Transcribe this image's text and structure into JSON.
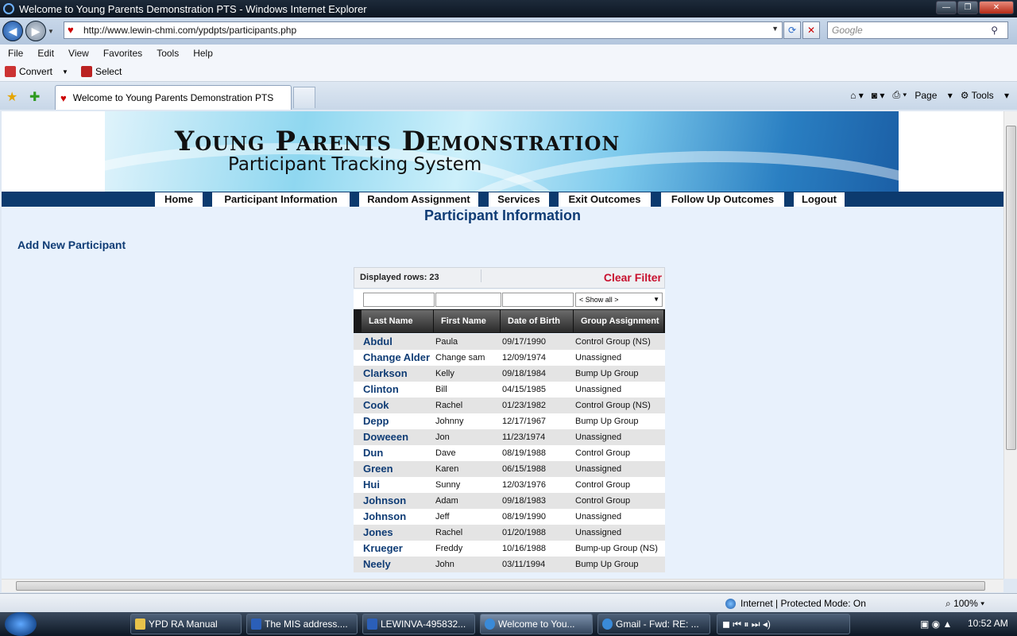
{
  "window": {
    "title": "Welcome to Young Parents Demonstration PTS - Windows Internet Explorer"
  },
  "address": {
    "url": "http://www.lewin-chmi.com/ypdpts/participants.php",
    "search_placeholder": "Google"
  },
  "menu": [
    "File",
    "Edit",
    "View",
    "Favorites",
    "Tools",
    "Help"
  ],
  "links": {
    "convert": "Convert",
    "select": "Select"
  },
  "tab": {
    "title": "Welcome to Young Parents Demonstration PTS"
  },
  "commands": {
    "page": "Page",
    "tools": "Tools"
  },
  "banner": {
    "title": "Young Parents Demonstration",
    "subtitle": "Participant Tracking System"
  },
  "nav": [
    "Home",
    "Participant Information",
    "Random Assignment",
    "Services",
    "Exit Outcomes",
    "Follow Up Outcomes",
    "Logout"
  ],
  "page": {
    "title": "Participant Information",
    "add_link": "Add New Participant"
  },
  "grid": {
    "displayed_rows": "Displayed rows: 23",
    "clear_filter": "Clear Filter",
    "group_filter": "< Show all >",
    "columns": [
      "Last Name",
      "First Name",
      "Date of Birth",
      "Group Assignment"
    ],
    "rows": [
      {
        "last": "Abdul",
        "first": "Paula",
        "dob": "09/17/1990",
        "group": "Control Group (NS)"
      },
      {
        "last": "Change Alder",
        "first": "Change sam",
        "dob": "12/09/1974",
        "group": "Unassigned"
      },
      {
        "last": "Clarkson",
        "first": "Kelly",
        "dob": "09/18/1984",
        "group": "Bump Up Group"
      },
      {
        "last": "Clinton",
        "first": "Bill",
        "dob": "04/15/1985",
        "group": "Unassigned"
      },
      {
        "last": "Cook",
        "first": "Rachel",
        "dob": "01/23/1982",
        "group": "Control Group (NS)"
      },
      {
        "last": "Depp",
        "first": "Johnny",
        "dob": "12/17/1967",
        "group": "Bump Up Group"
      },
      {
        "last": "Doweeen",
        "first": "Jon",
        "dob": "11/23/1974",
        "group": "Unassigned"
      },
      {
        "last": "Dun",
        "first": "Dave",
        "dob": "08/19/1988",
        "group": "Control Group"
      },
      {
        "last": "Green",
        "first": "Karen",
        "dob": "06/15/1988",
        "group": "Unassigned"
      },
      {
        "last": "Hui",
        "first": "Sunny",
        "dob": "12/03/1976",
        "group": "Control Group"
      },
      {
        "last": "Johnson",
        "first": "Adam",
        "dob": "09/18/1983",
        "group": "Control Group"
      },
      {
        "last": "Johnson",
        "first": "Jeff",
        "dob": "08/19/1990",
        "group": "Unassigned"
      },
      {
        "last": "Jones",
        "first": "Rachel",
        "dob": "01/20/1988",
        "group": "Unassigned"
      },
      {
        "last": "Krueger",
        "first": "Freddy",
        "dob": "10/16/1988",
        "group": "Bump-up Group (NS)"
      },
      {
        "last": "Neely",
        "first": "John",
        "dob": "03/11/1994",
        "group": "Bump Up Group"
      }
    ]
  },
  "status": {
    "zone": "Internet | Protected Mode: On",
    "zoom": "100%"
  },
  "taskbar": {
    "items": [
      "YPD RA Manual",
      "The MIS address....",
      "LEWINVA-495832...",
      "Welcome to You...",
      "Gmail - Fwd: RE: ..."
    ],
    "clock": "10:52 AM"
  }
}
